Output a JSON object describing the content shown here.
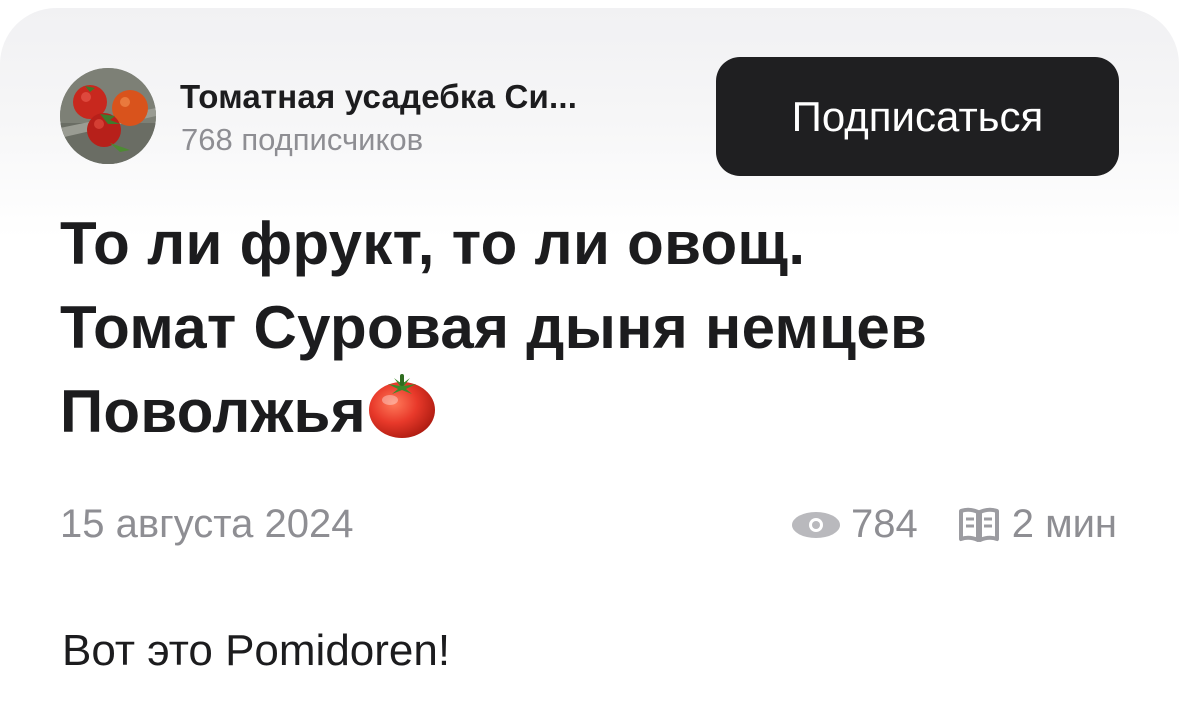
{
  "channel": {
    "name": "Томатная усадебка Си...",
    "subscribers": "768 подписчиков",
    "avatar_icon": "tomatoes-photo"
  },
  "subscribe_button": {
    "label": "Подписаться"
  },
  "article": {
    "title_line1": "То ли фрукт, то ли овощ.",
    "title_line2": "Томат Суровая дыня немцев",
    "title_line3": "Поволжья",
    "title_emoji_icon": "tomato-icon",
    "date": "15 августа 2024",
    "views": "784",
    "read_time": "2 мин",
    "body": "Вот это Pomidoren!"
  },
  "colors": {
    "button_bg": "#1f1f21",
    "muted_text": "#8e8e93",
    "primary_text": "#1c1c1e"
  }
}
